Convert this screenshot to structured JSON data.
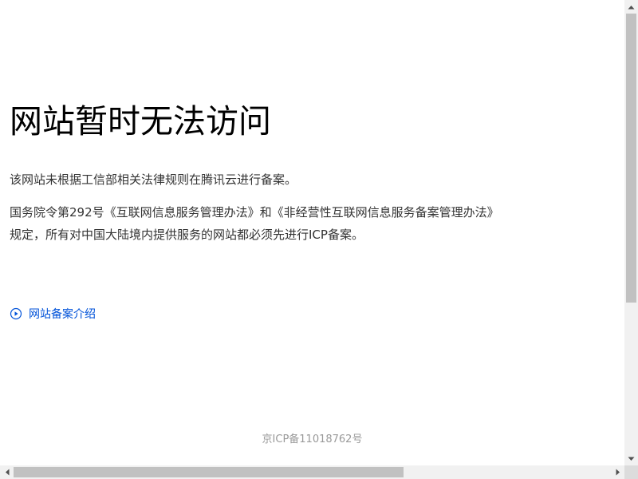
{
  "page": {
    "title": "网站暂时无法访问",
    "paragraph1": "该网站未根据工信部相关法律规则在腾讯云进行备案。",
    "paragraph2_line1": "国务院令第292号《互联网信息服务管理办法》和《非经营性互联网信息服务备案管理办法》",
    "paragraph2_line2": "规定，所有对中国大陆境内提供服务的网站都必须先进行ICP备案。",
    "link_label": "网站备案介绍",
    "link_icon": "play-circle-icon",
    "footer": "京ICP备11018762号"
  },
  "colors": {
    "link": "#0052d9",
    "text": "#333333",
    "title": "#000000",
    "footer": "#999999"
  }
}
